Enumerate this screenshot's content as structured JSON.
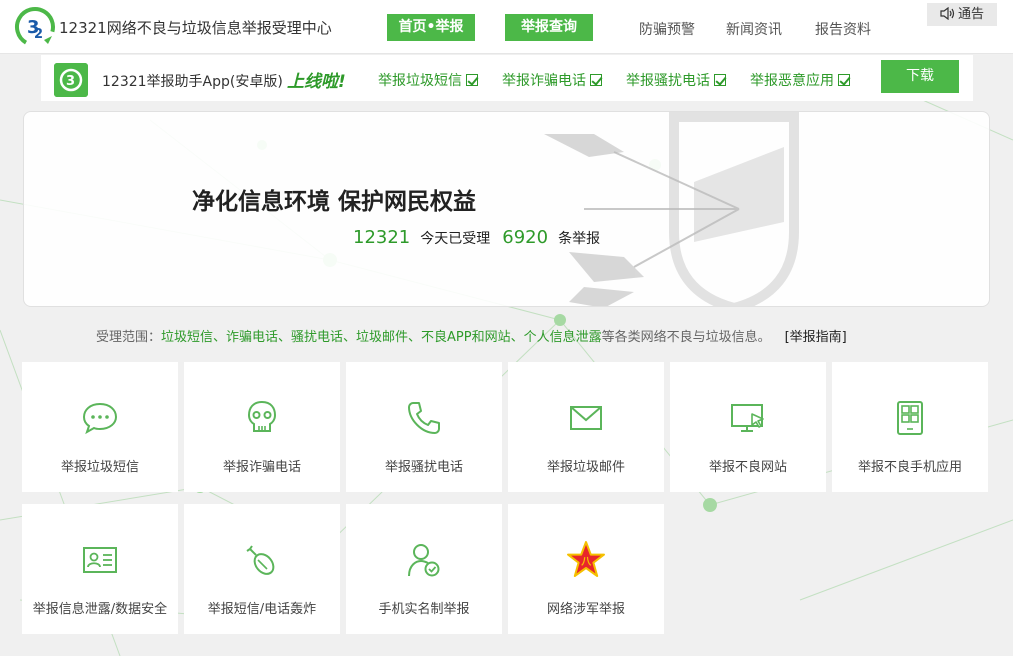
{
  "header": {
    "site_title": "12321网络不良与垃圾信息举报受理中心",
    "nav_home": "首页•举报",
    "nav_query": "举报查询",
    "nav_warn": "防骗预警",
    "nav_news": "新闻资讯",
    "nav_reports": "报告资料",
    "notice": "通告"
  },
  "appbar": {
    "text": "12321举报助手App(安卓版)",
    "online": "上线啦!",
    "features": [
      "举报垃圾短信",
      "举报诈骗电话",
      "举报骚扰电话",
      "举报恶意应用"
    ],
    "download": "下载"
  },
  "hero": {
    "slogan": "净化信息环境 保护网民权益",
    "count_accepted": "12321",
    "label_accepted": "今天已受理",
    "count_reports": "6920",
    "label_reports": "条举报"
  },
  "scope": {
    "prefix": "受理范围：",
    "items": "垃圾短信、诈骗电话、骚扰电话、垃圾邮件、不良APP和网站、个人信息泄露",
    "suffix": "等各类网络不良与垃圾信息。",
    "guide": "[举报指南]"
  },
  "tiles": [
    {
      "label": "举报垃圾短信",
      "icon": "sms-bubble-icon"
    },
    {
      "label": "举报诈骗电话",
      "icon": "skull-icon"
    },
    {
      "label": "举报骚扰电话",
      "icon": "phone-icon"
    },
    {
      "label": "举报垃圾邮件",
      "icon": "envelope-icon"
    },
    {
      "label": "举报不良网站",
      "icon": "monitor-cursor-icon"
    },
    {
      "label": "举报不良手机应用",
      "icon": "mobile-apps-icon"
    },
    {
      "label": "举报信息泄露/数据安全",
      "icon": "id-card-icon"
    },
    {
      "label": "举报短信/电话轰炸",
      "icon": "bomb-icon"
    },
    {
      "label": "手机实名制举报",
      "icon": "user-check-icon"
    },
    {
      "label": "网络涉军举报",
      "icon": "army-star-icon"
    }
  ],
  "colors": {
    "brand_green": "#4cb848",
    "text_green": "#2e9a2a",
    "army_red": "#e8262b",
    "army_gold": "#f5c000"
  }
}
